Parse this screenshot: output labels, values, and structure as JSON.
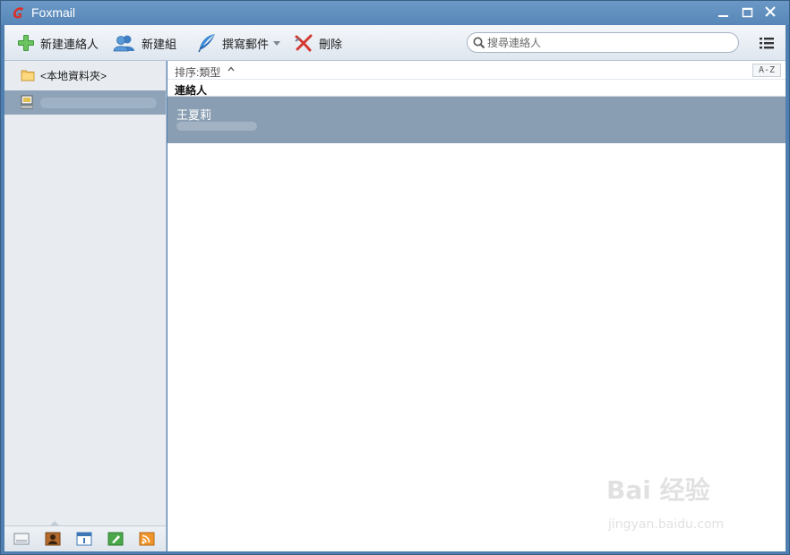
{
  "window": {
    "title": "Foxmail"
  },
  "toolbar": {
    "new_contact_label": "新建連絡人",
    "new_group_label": "新建組",
    "compose_label": "撰寫郵件",
    "delete_label": "刪除"
  },
  "search": {
    "placeholder": "搜尋連絡人"
  },
  "sidebar": {
    "folder_label": "<本地資料夾>",
    "selected_account": ""
  },
  "main": {
    "sort_label": "排序:類型",
    "az_label": "A-Z",
    "group_header": "連絡人",
    "contacts": [
      {
        "name": "王夏莉"
      }
    ]
  },
  "watermark": {
    "brand": "Bai 经验",
    "url": "jingyan.baidu.com"
  },
  "colors": {
    "title_bar": "#5787b8",
    "selection": "#8a9eb3",
    "sidebar_bg": "#e8ecf1",
    "logo_red": "#d6312b"
  }
}
